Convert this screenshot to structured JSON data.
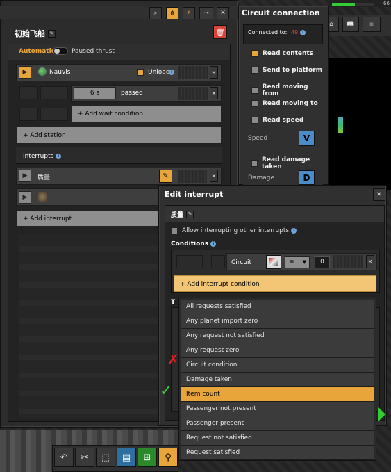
{
  "main": {
    "title": "初始飞船",
    "auto_label": "Automatic",
    "paused_label": "Paused thrust",
    "station": "Nauvis",
    "unload": "Unload",
    "wait_time": "6 s",
    "passed": "passed",
    "add_wait": "+ Add wait condition",
    "add_station": "+ Add station",
    "interrupts_label": "Interrupts",
    "interrupt1": "质量",
    "add_interrupt": "+ Add interrupt"
  },
  "circuit": {
    "title": "Circuit connection",
    "connected_label": "Connected to:",
    "connected_value": "49",
    "read_contents": "Read contents",
    "send_platform": "Send to platform",
    "read_moving_from": "Read moving from",
    "read_moving_to": "Read moving to",
    "read_speed": "Read speed",
    "speed_label": "Speed",
    "speed_signal": "V",
    "read_damage": "Read damage taken",
    "damage_label": "Damage",
    "damage_signal": "D"
  },
  "interrupt": {
    "title": "Edit interrupt",
    "name": "质量",
    "allow_label": "Allow interrupting other interrupts",
    "conditions_label": "Conditions",
    "circuit_label": "Circuit",
    "comparator": "=",
    "value": "0",
    "add_condition": "+ Add interrupt condition",
    "targets_label": "T"
  },
  "dropdown": {
    "items": [
      "All requests satisfied",
      "Any planet import zero",
      "Any request not satisfied",
      "Any request zero",
      "Circuit condition",
      "Damage taken",
      "Item count",
      "Passenger not present",
      "Passenger present",
      "Request not satisfied",
      "Request satisfied"
    ],
    "selected": "Item count"
  },
  "annotations": {
    "wrong_mark": "✗",
    "correct_mark": "✓"
  },
  "colors": {
    "accent": "#e8a63a",
    "panel": "#313031",
    "info": "#6fa6d9",
    "danger": "#d9433a"
  },
  "hud": {
    "top_right_number": "66"
  }
}
